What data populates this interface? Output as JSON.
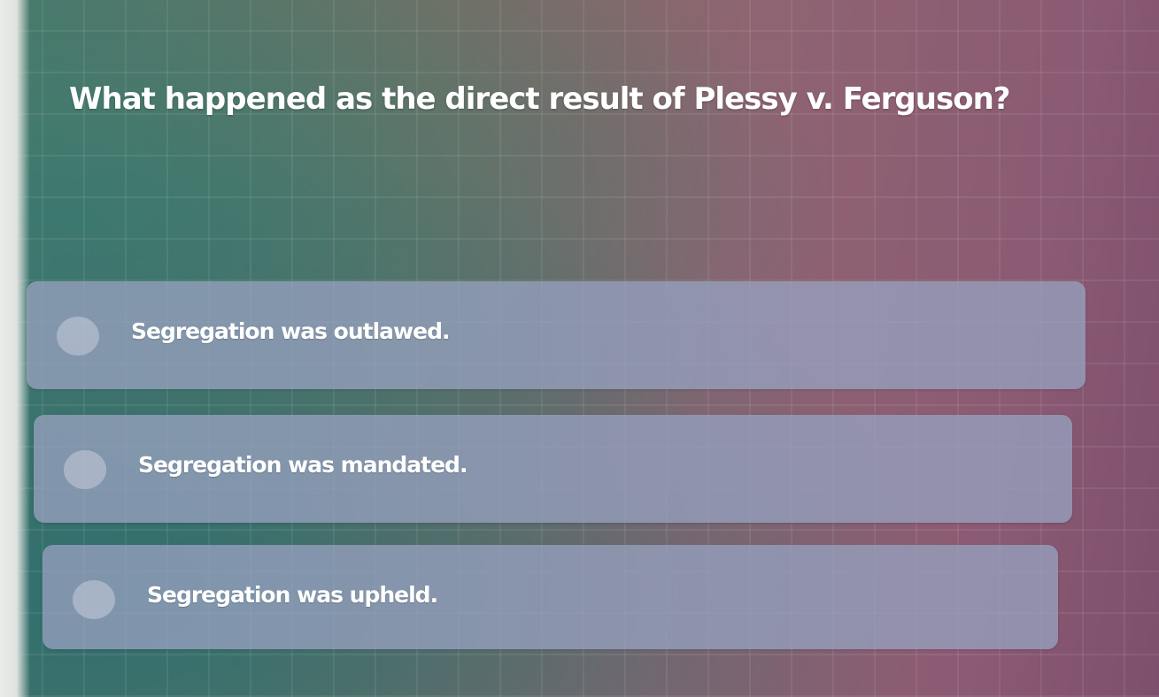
{
  "question": {
    "text": "What happened as the direct result of Plessy v. Ferguson?"
  },
  "options": [
    {
      "label": "Segregation was outlawed."
    },
    {
      "label": "Segregation was mandated."
    },
    {
      "label": "Segregation was upheld."
    }
  ],
  "colors": {
    "option_background": "#96a0be",
    "radio_fill": "#c8cddc",
    "text": "#ffffff"
  }
}
